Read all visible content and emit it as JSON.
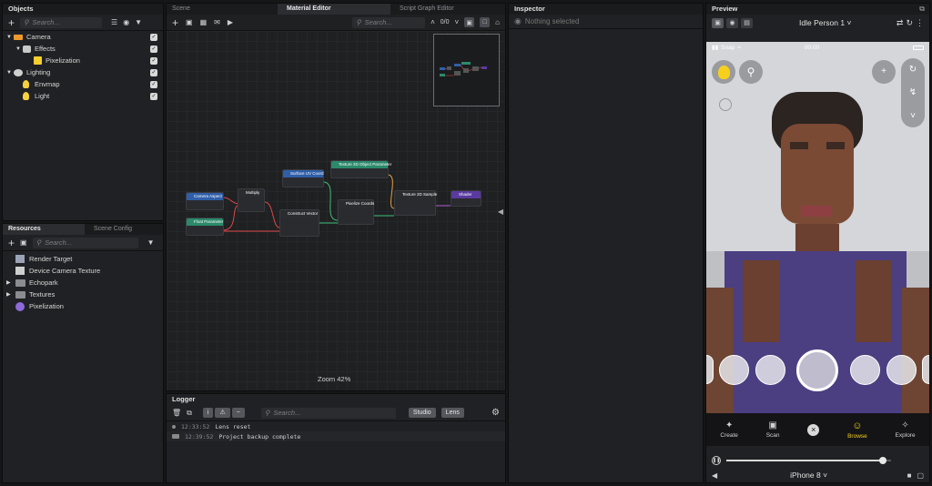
{
  "objects": {
    "title": "Objects",
    "search_placeholder": "Search...",
    "tree": [
      {
        "label": "Camera"
      },
      {
        "label": "Effects"
      },
      {
        "label": "Pixelization"
      },
      {
        "label": "Lighting"
      },
      {
        "label": "Envmap"
      },
      {
        "label": "Light"
      }
    ]
  },
  "resources": {
    "tabs": [
      "Resources",
      "Scene Config"
    ],
    "search_placeholder": "Search...",
    "items": [
      {
        "label": "Render Target"
      },
      {
        "label": "Device Camera Texture"
      },
      {
        "label": "Echopark"
      },
      {
        "label": "Textures"
      },
      {
        "label": "Pixelization"
      }
    ]
  },
  "editor": {
    "tabs": [
      "Scene",
      "Material Editor",
      "Script Graph Editor"
    ],
    "search_placeholder": "Search...",
    "search_count": "0/0",
    "zoom": "Zoom 42%",
    "nodes": [
      {
        "title": "Camera Aspect",
        "sub": ""
      },
      {
        "title": "Float Parameter",
        "sub": ""
      },
      {
        "title": "Multiply",
        "sub": ""
      },
      {
        "title": "Surface UV Coord",
        "sub": ""
      },
      {
        "title": "Construct Vector",
        "sub": ""
      },
      {
        "title": "Texture 2D Object Parameter",
        "sub": ""
      },
      {
        "title": "Pixelize Coords",
        "sub": ""
      },
      {
        "title": "Texture 2D Sample",
        "sub": ""
      },
      {
        "title": "Shader",
        "sub": ""
      }
    ]
  },
  "logger": {
    "title": "Logger",
    "search_placeholder": "Search...",
    "filters": [
      "Studio",
      "Lens"
    ],
    "rows": [
      {
        "time": "12:33:52",
        "msg": "Lens reset"
      },
      {
        "time": "12:39:52",
        "msg": "Project backup complete"
      }
    ]
  },
  "inspector": {
    "title": "Inspector",
    "empty": "Nothing selected"
  },
  "preview": {
    "title": "Preview",
    "person": "Idle Person 1",
    "carrier": "Snap",
    "clock": "00:00",
    "nav": [
      "Create",
      "Scan",
      "Browse",
      "Explore"
    ],
    "device": "iPhone 8",
    "progress": 0.95
  }
}
